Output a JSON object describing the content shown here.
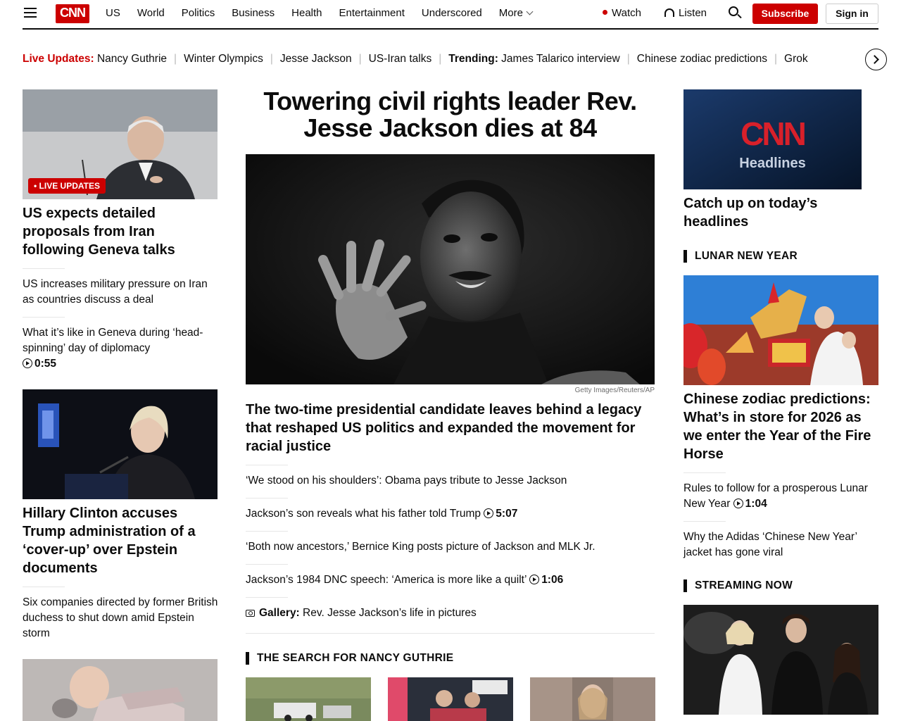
{
  "header": {
    "logo": "CNN",
    "nav": [
      "US",
      "World",
      "Politics",
      "Business",
      "Health",
      "Entertainment",
      "Underscored",
      "More"
    ],
    "watch": "Watch",
    "listen": "Listen",
    "subscribe": "Subscribe",
    "signin": "Sign in"
  },
  "ticker": {
    "live_label": "Live Updates:",
    "live_items": [
      "Nancy Guthrie",
      "Winter Olympics",
      "Jesse Jackson",
      "US-Iran talks"
    ],
    "trending_label": "Trending:",
    "trending_items": [
      "James Talarico interview",
      "Chinese zodiac predictions",
      "Grok"
    ]
  },
  "left": {
    "story1": {
      "badge": "• LIVE UPDATES",
      "headline": "US expects detailed proposals from Iran following Geneva talks",
      "links": [
        "US increases military pressure on Iran as countries discuss a deal",
        "What it’s like in Geneva during ‘head-spinning’ day of diplomacy"
      ],
      "video_duration": "0:55"
    },
    "story2": {
      "headline": "Hillary Clinton accuses Trump administration of a ‘cover-up’ over Epstein documents",
      "links": [
        "Six companies directed by former British duchess to shut down amid Epstein storm"
      ]
    }
  },
  "center": {
    "title": "Towering civil rights leader Rev. Jesse Jackson dies at 84",
    "image_credit": "Getty Images/Reuters/AP",
    "subhead": "The two-time presidential candidate leaves behind a legacy that reshaped US politics and expanded the movement for racial justice",
    "links": [
      {
        "text": "‘We stood on his shoulders’: Obama pays tribute to Jesse Jackson",
        "duration": ""
      },
      {
        "text": "Jackson’s son reveals what his father told Trump",
        "duration": "5:07"
      },
      {
        "text": "‘Both now ancestors,’ Bernice King posts picture of Jackson and MLK Jr.",
        "duration": ""
      },
      {
        "text": "Jackson’s 1984 DNC speech: ‘America is more like a quilt’",
        "duration": "1:06"
      }
    ],
    "gallery_label": "Gallery:",
    "gallery_text": "Rev. Jesse Jackson’s life in pictures",
    "section": "THE SEARCH FOR NANCY GUTHRIE"
  },
  "right": {
    "promo_brand": "CNN",
    "promo_label": "Headlines",
    "promo_headline": "Catch up on today’s headlines",
    "section1": "LUNAR NEW YEAR",
    "lny_headline": "Chinese zodiac predictions: What’s in store for 2026 as we enter the Year of the Fire Horse",
    "lny_links": [
      {
        "text": "Rules to follow for a prosperous Lunar New Year",
        "duration": "1:04"
      },
      {
        "text": "Why the Adidas ‘Chinese New Year’ jacket has gone viral",
        "duration": ""
      }
    ],
    "section2": "STREAMING NOW"
  },
  "colors": {
    "brand_red": "#cc0000",
    "text": "#0c0c0c",
    "divider": "#e6e6e6"
  }
}
